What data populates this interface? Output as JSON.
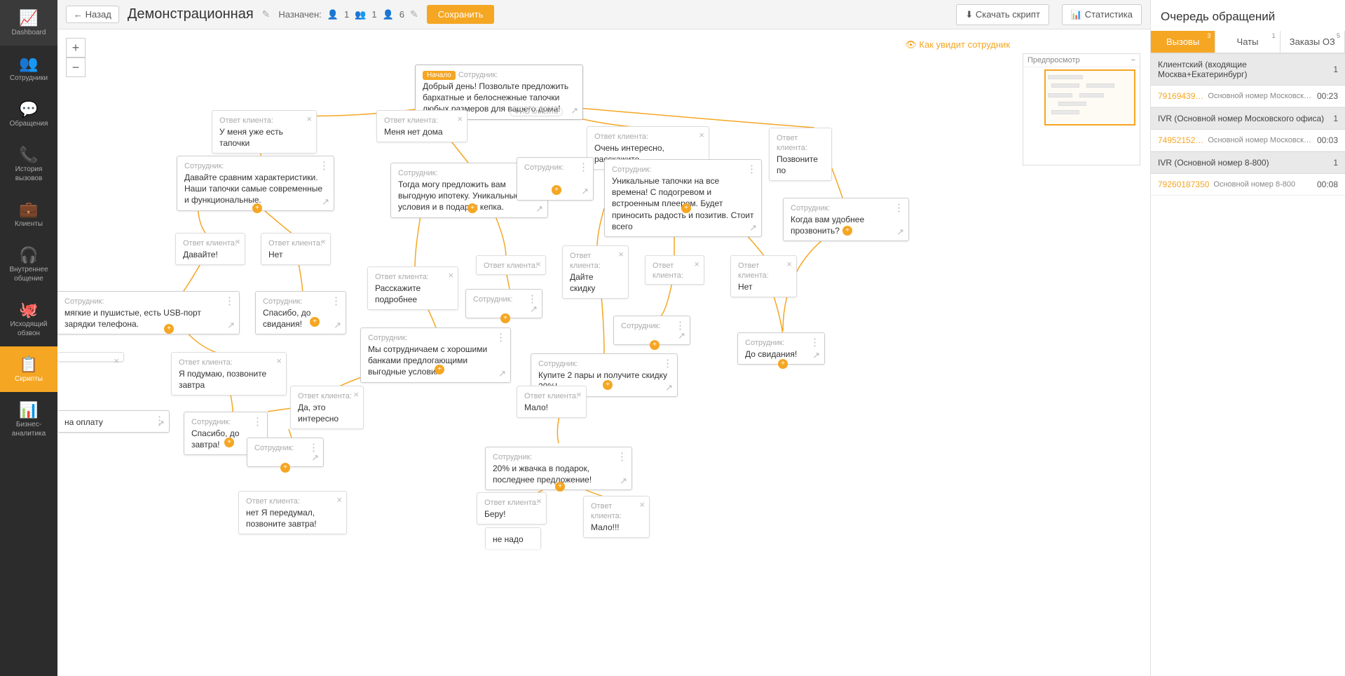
{
  "sidebar": {
    "items": [
      {
        "label": "Dashboard",
        "icon": "📈"
      },
      {
        "label": "Сотрудники",
        "icon": "👥"
      },
      {
        "label": "Обращения",
        "icon": "💬"
      },
      {
        "label": "История вызовов",
        "icon": "📞"
      },
      {
        "label": "Клиенты",
        "icon": "💼"
      },
      {
        "label": "Внутреннее общение",
        "icon": "🎧"
      },
      {
        "label": "Исходящий обзвон",
        "icon": "🐙"
      },
      {
        "label": "Скрипты",
        "icon": "📋"
      },
      {
        "label": "Бизнес-аналитика",
        "icon": "📊"
      }
    ]
  },
  "header": {
    "back": "Назад",
    "title": "Демонстрационная",
    "assigned_label": "Назначен:",
    "count1": "1",
    "count2": "1",
    "count3": "6",
    "save": "Сохранить",
    "download": "Скачать скрипт",
    "stats": "Статистика"
  },
  "canvas": {
    "preview_employee": "Как увидит сотрудник",
    "minimap_title": "Предпросмотр",
    "labels": {
      "start": "Начало",
      "employee": "Сотрудник:",
      "client": "Ответ клиента:",
      "fio": "ФИО клиента"
    },
    "nodes": {
      "start_text": "Добрый день! Позвольте предложить бархатные и белоснежные тапочки любых размеров для вашего дома!",
      "c_slippers": "У меня уже есть тапочки",
      "c_nothome": "Меня нет дома",
      "c_interesting": "Очень интересно, расскажите",
      "c_callback": "Позвоните по",
      "e_compare": "Давайте сравним характеристики. Наши тапочки самые современные и функциональные.",
      "e_mortgage": "Тогда могу предложить вам выгодную ипотеку. Уникальные условия и в подарок кепка.",
      "e_unique": "Уникальные тапочки на все времена! С подогревом и встроенным плеером. Будет приносить радость и позитив. Стоит всего",
      "e_whencall": "Когда вам удобнее прозвонить?",
      "c_yes": "Давайте!",
      "c_no": "Нет",
      "c_more": "Расскажите подробнее",
      "c_discount": "Дайте скидку",
      "c_no2": "Нет",
      "e_soft": "мягкие и пушистые, есть USB-порт зарядки телефона.",
      "e_thanks": "Спасибо, до свидания!",
      "e_bye2": "До свидания!",
      "e_banks": "Мы сотрудничаем с хорошими банками предлогающими выгодные условия",
      "e_buy2": "Купите 2 пары и получите скидку 20%!",
      "c_think": "Я подумаю, позвоните завтра",
      "c_yesint": "Да, это интересно",
      "c_few": "Мало!",
      "e_tom": "Спасибо, до завтра!",
      "e_20gum": "20% и жвачка в подарок, последнее предложение!",
      "c_changed": "нет Я передумал, позвоните завтра!",
      "c_take": "Беру!",
      "c_few2": "Мало!!!",
      "c_nono": "не надо",
      "e_payment": "на оплату"
    }
  },
  "right": {
    "title": "Очередь обращений",
    "tabs": [
      {
        "label": "Вызовы",
        "badge": "3"
      },
      {
        "label": "Чаты",
        "badge": "1"
      },
      {
        "label": "Заказы ОЗ",
        "badge": "5"
      }
    ],
    "queue": [
      {
        "type": "hdr",
        "label": "Клиентский (входящие Москва+Екатеринбург)",
        "cnt": "1"
      },
      {
        "type": "row",
        "num": "79169439…",
        "desc": "Основной номер Московского офи…",
        "time": "00:23"
      },
      {
        "type": "hdr",
        "label": "IVR  (Основной номер Московского офиса)",
        "cnt": "1"
      },
      {
        "type": "row",
        "num": "74952152…",
        "desc": "Основной номер Московского оф…",
        "time": "00:03"
      },
      {
        "type": "hdr",
        "label": "IVR  (Основной номер 8-800)",
        "cnt": "1"
      },
      {
        "type": "row",
        "num": "79260187350",
        "desc": "Основной номер 8-800",
        "time": "00:08"
      }
    ]
  }
}
